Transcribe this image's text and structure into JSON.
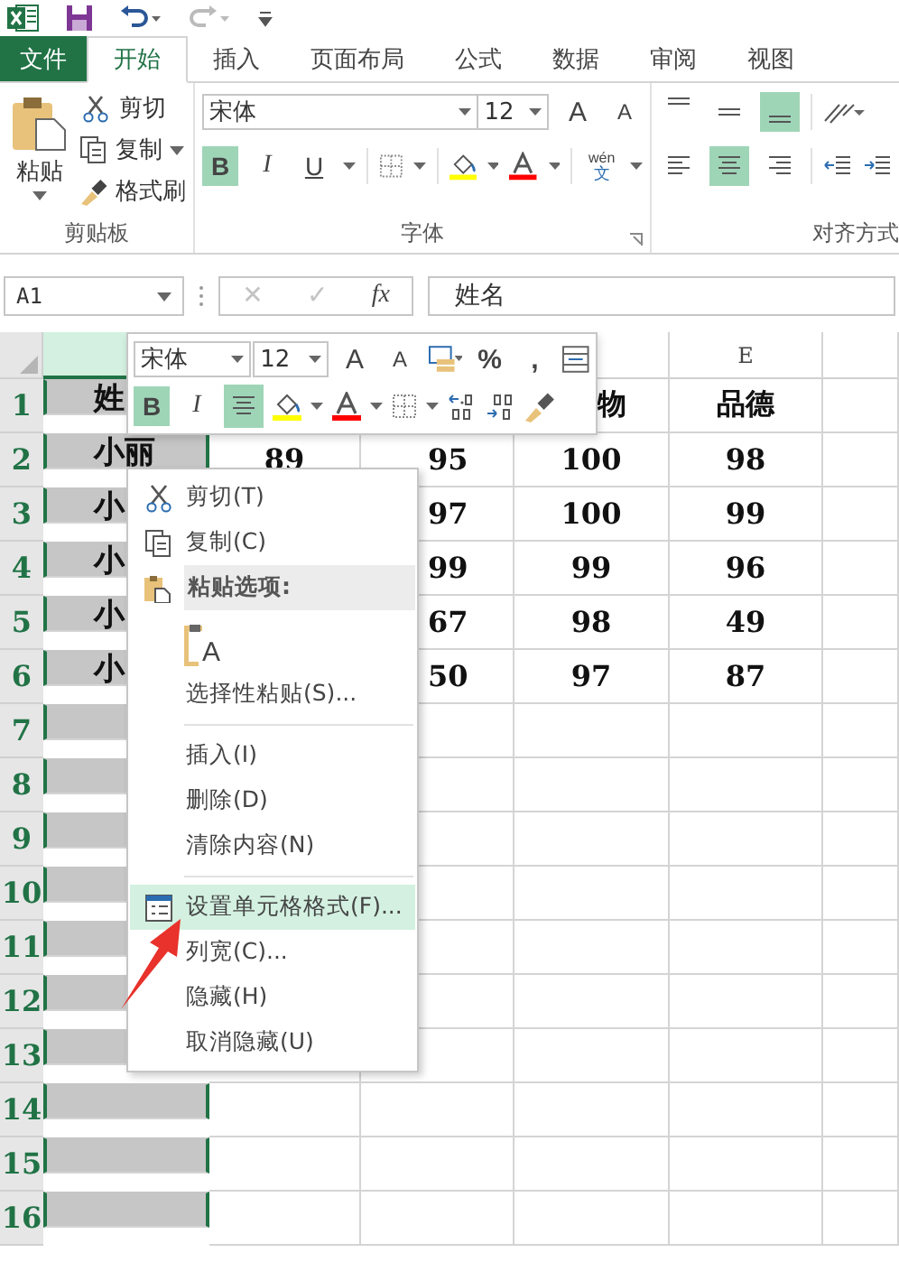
{
  "tabs": [
    {
      "label": "文件",
      "kind": "file",
      "selected": false
    },
    {
      "label": "开始",
      "kind": "tab",
      "selected": true
    },
    {
      "label": "插入",
      "kind": "tab",
      "selected": false
    },
    {
      "label": "页面布局",
      "kind": "tab",
      "selected": false
    },
    {
      "label": "公式",
      "kind": "tab",
      "selected": false
    },
    {
      "label": "数据",
      "kind": "tab",
      "selected": false
    },
    {
      "label": "审阅",
      "kind": "tab",
      "selected": false
    },
    {
      "label": "视图",
      "kind": "tab",
      "selected": false
    }
  ],
  "ribbon": {
    "clipboard": {
      "paste": "粘贴",
      "cut": "剪切",
      "copy": "复制",
      "format_painter": "格式刷",
      "label": "剪贴板"
    },
    "font": {
      "font_name": "宋体",
      "font_size": "12",
      "grow": "A",
      "shrink": "A",
      "bold": {
        "label": "B",
        "on": true
      },
      "italic": {
        "label": "I",
        "on": false
      },
      "underline": {
        "label": "U",
        "on": false
      },
      "phonetic_top": "wén",
      "phonetic_bottom": "文",
      "label": "字体"
    },
    "alignment": {
      "label": "对齐方式",
      "vertical": [
        {
          "selected": false
        },
        {
          "selected": false
        },
        {
          "selected": true
        }
      ],
      "horizontal": [
        {
          "selected": false
        },
        {
          "selected": true
        },
        {
          "selected": false
        }
      ]
    }
  },
  "formula_bar": {
    "name_box": "A1",
    "cancel": "✕",
    "enter": "✓",
    "fx": "fx",
    "content": "姓名"
  },
  "sheet": {
    "columns": [
      {
        "selected": true
      },
      {
        "selected": false
      },
      {
        "selected": false
      },
      {
        "selected": false
      },
      {
        "label": "E",
        "selected": false
      },
      {
        "selected": false
      }
    ],
    "rows": [
      {
        "header": "1",
        "cells": {
          "A": "姓",
          "D": "物",
          "E": "品德"
        }
      },
      {
        "header": "2",
        "cells": {
          "A": "小丽",
          "B": "89",
          "C": "95",
          "D": "100",
          "E": "98"
        }
      },
      {
        "header": "3",
        "cells": {
          "A": "小",
          "C": "97",
          "D": "100",
          "E": "99"
        }
      },
      {
        "header": "4",
        "cells": {
          "A": "小",
          "C": "99",
          "D": "99",
          "E": "96"
        }
      },
      {
        "header": "5",
        "cells": {
          "A": "小",
          "C": "67",
          "D": "98",
          "E": "49"
        }
      },
      {
        "header": "6",
        "cells": {
          "A": "小",
          "C": "50",
          "D": "97",
          "E": "87"
        }
      },
      {
        "header": "7",
        "cells": {}
      },
      {
        "header": "8",
        "cells": {}
      },
      {
        "header": "9",
        "cells": {}
      },
      {
        "header": "10",
        "cells": {}
      },
      {
        "header": "11",
        "cells": {}
      },
      {
        "header": "12",
        "cells": {}
      },
      {
        "header": "13",
        "cells": {}
      },
      {
        "header": "14",
        "cells": {}
      },
      {
        "header": "15",
        "cells": {}
      },
      {
        "header": "16",
        "cells": {}
      }
    ]
  },
  "mini_toolbar": {
    "font_name": "宋体",
    "font_size": "12",
    "grow": "A",
    "shrink": "A",
    "percent": "%",
    "comma": ",",
    "bold": {
      "label": "B",
      "on": true
    },
    "italic": {
      "label": "I",
      "on": false
    },
    "center": {
      "on": true
    }
  },
  "context_menu": [
    {
      "kind": "cut",
      "label": "剪切(T)",
      "selected": false
    },
    {
      "kind": "copy",
      "label": "复制(C)",
      "selected": false
    },
    {
      "kind": "header",
      "label": "粘贴选项:"
    },
    {
      "kind": "paste_options",
      "glyph": "A"
    },
    {
      "kind": "item",
      "label": "选择性粘贴(S)...",
      "selected": false
    },
    {
      "kind": "separator"
    },
    {
      "kind": "item",
      "label": "插入(I)",
      "selected": false
    },
    {
      "kind": "item",
      "label": "删除(D)",
      "selected": false
    },
    {
      "kind": "item",
      "label": "清除内容(N)",
      "selected": false
    },
    {
      "kind": "separator"
    },
    {
      "kind": "format",
      "label": "设置单元格格式(F)...",
      "selected": true
    },
    {
      "kind": "item",
      "label": "列宽(C)...",
      "selected": false
    },
    {
      "kind": "item",
      "label": "隐藏(H)",
      "selected": false
    },
    {
      "kind": "item",
      "label": "取消隐藏(U)",
      "selected": false
    }
  ]
}
